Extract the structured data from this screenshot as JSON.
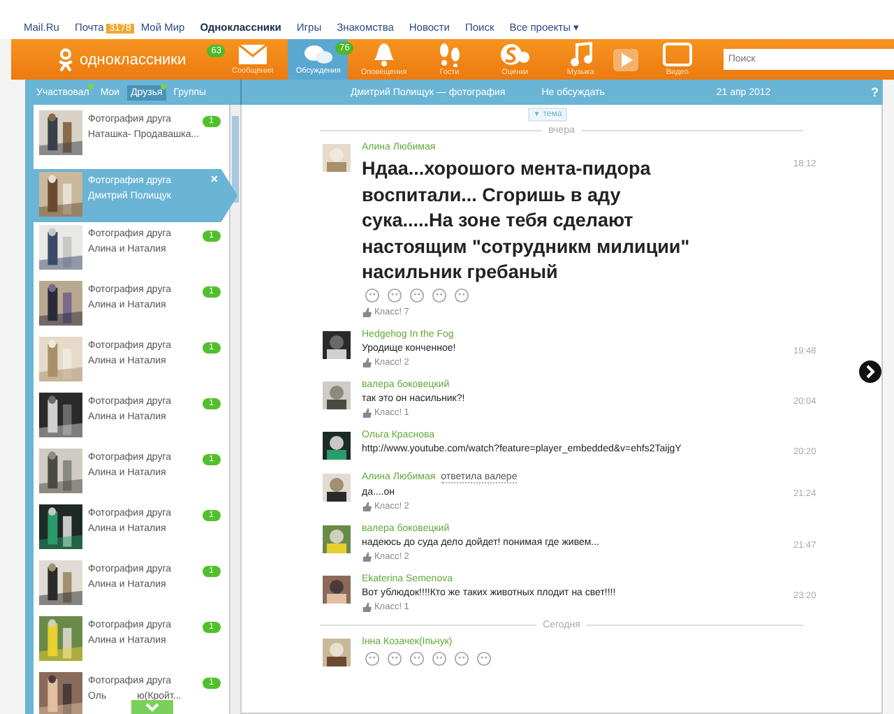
{
  "portal_links": [
    {
      "label": "Mail.Ru",
      "bold": false
    },
    {
      "label": "Почта",
      "bold": false,
      "badge": "3178"
    },
    {
      "label": "Мой Мир",
      "bold": false
    },
    {
      "label": "Одноклассники",
      "bold": true
    },
    {
      "label": "Игры",
      "bold": false
    },
    {
      "label": "Знакомства",
      "bold": false
    },
    {
      "label": "Новости",
      "bold": false
    },
    {
      "label": "Поиск",
      "bold": false
    },
    {
      "label": "Все проекты",
      "bold": false,
      "caret": "▾"
    }
  ],
  "logo": {
    "text": "одноклассники",
    "badge": "63"
  },
  "nav": [
    {
      "kind": "mail",
      "label": "Сообщения",
      "selected": false
    },
    {
      "kind": "chat",
      "label": "Обсуждения",
      "selected": true,
      "badge": "76"
    },
    {
      "kind": "bell",
      "label": "Оповещения",
      "selected": false
    },
    {
      "kind": "feet",
      "label": "Гости",
      "selected": false
    },
    {
      "kind": "coin",
      "label": "Оценки",
      "selected": false
    },
    {
      "kind": "note",
      "label": "Музыка",
      "selected": false
    },
    {
      "kind": "play",
      "selected": false
    },
    {
      "kind": "screen",
      "label": "Видео",
      "selected": false
    }
  ],
  "search": {
    "placeholder": "Поиск"
  },
  "filter_tabs": [
    {
      "label": "Участвовал",
      "selected": false,
      "dot": true
    },
    {
      "label": "Мои",
      "selected": false,
      "dot": false
    },
    {
      "label": "Друзья",
      "selected": true,
      "dot": true
    },
    {
      "label": "Группы",
      "selected": false,
      "dot": false
    }
  ],
  "topic_bar": {
    "title": "Дмитрий Полищук — фотография",
    "action": "Не обсуждать",
    "date": "21 апр 2012",
    "help": "?"
  },
  "discussions": [
    {
      "title": "Фотография друга",
      "subtitle": "Наташка- Продавашка...",
      "count": "1",
      "selected": false
    },
    {
      "title": "Фотография друга",
      "subtitle": "Дмитрий Полищук",
      "selected": true,
      "close": "×"
    },
    {
      "title": "Фотография друга",
      "subtitle": "Алина и Наталия",
      "count": "1",
      "selected": false
    },
    {
      "title": "Фотография друга",
      "subtitle": "Алина и Наталия",
      "count": "1",
      "selected": false
    },
    {
      "title": "Фотография друга",
      "subtitle": "Алина и Наталия",
      "count": "1",
      "selected": false
    },
    {
      "title": "Фотография друга",
      "subtitle": "Алина и Наталия",
      "count": "1",
      "selected": false
    },
    {
      "title": "Фотография друга",
      "subtitle": "Алина и Наталия",
      "count": "1",
      "selected": false
    },
    {
      "title": "Фотография друга",
      "subtitle": "Алина и Наталия",
      "count": "1",
      "selected": false
    },
    {
      "title": "Фотография друга",
      "subtitle": "Алина и Наталия",
      "count": "1",
      "selected": false
    },
    {
      "title": "Фотография друга",
      "subtitle": "Алина и Наталия",
      "count": "1",
      "selected": false
    },
    {
      "title": "Фотография друга",
      "subtitle": "Оль",
      "subtitle_end": "ю(Кройт...",
      "count": "1",
      "selected": false
    }
  ],
  "topic_button": {
    "icon": "▼",
    "label": "тема"
  },
  "feed": [
    {
      "kind": "divider",
      "label": "вчера"
    },
    {
      "kind": "message",
      "author": "Алина Любимая",
      "text": "Ндаа...хорошого мента-пидора воспитали... Сгоришь в аду сука.....На зоне тебя сделают настоящим \"сотрудникм милиции\" насильник гребаный",
      "large": true,
      "emoticons": [
        {
          "kind": "smiley"
        },
        {
          "kind": "smiley"
        },
        {
          "kind": "smiley"
        },
        {
          "kind": "smiley"
        },
        {
          "kind": "smiley"
        }
      ],
      "like": "Класс! 7",
      "time": "18:12"
    },
    {
      "kind": "message",
      "author": "Hedgehog In the Fog",
      "text": "Уродище конченное!",
      "large": false,
      "like": "Класс! 2",
      "time": "19:48"
    },
    {
      "kind": "message",
      "author": "валера боковецкий",
      "text": "так это он насильник?!",
      "large": false,
      "like": "Класс! 1",
      "time": "20:04"
    },
    {
      "kind": "message",
      "author": "Ольга Краснова",
      "text": "http://www.youtube.com/watch?feature=player_embedded&v=ehfs2TaijgY",
      "large": false,
      "time": "20:20"
    },
    {
      "kind": "message",
      "author": "Алина Любимая",
      "reply_to": "ответила валере",
      "text": "да....он",
      "large": false,
      "like": "Класс! 2",
      "time": "21:24"
    },
    {
      "kind": "message",
      "author": "валера боковецкий",
      "text": "надеюсь до суда дело дойдет! понимая где живем...",
      "large": false,
      "like": "Класс! 2",
      "time": "21:47"
    },
    {
      "kind": "message",
      "author": "Ekaterina Semenova",
      "text": "Вот ублюдок!!!!Кто же таких животных плодит на свет!!!!",
      "large": false,
      "like": "Класс! 1",
      "time": "23:20"
    },
    {
      "kind": "divider",
      "label": "Сегодня"
    },
    {
      "kind": "message",
      "author": "Інна Козачек(Іпьчук)",
      "emoticons": [
        {
          "kind": "smiley"
        },
        {
          "kind": "smiley"
        },
        {
          "kind": "smiley"
        },
        {
          "kind": "smiley"
        },
        {
          "kind": "smiley"
        },
        {
          "kind": "smiley"
        }
      ]
    }
  ]
}
